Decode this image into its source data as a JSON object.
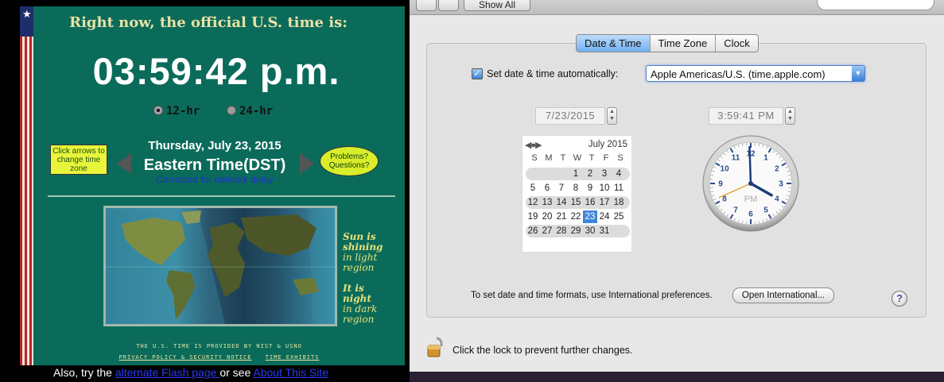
{
  "nist": {
    "headline": "Right now, the official U.S. time is:",
    "time": "03:59:42 p.m.",
    "format_12": "12-hr",
    "format_24": "24-hr",
    "click_arrows": "Click arrows to change time zone",
    "date": "Thursday, July 23, 2015",
    "timezone": "Eastern Time(DST)",
    "corrected": "Corrected for network delay",
    "problems": "Problems? Questions?",
    "sun_line1": "Sun is",
    "sun_line2": "shining",
    "sun_line3": "in light",
    "sun_line4": "region",
    "night_line1": "It is",
    "night_line2": "night",
    "night_line3": "in dark",
    "night_line4": "region",
    "provided": "THE U.S. TIME IS PROVIDED BY NIST & USNO",
    "privacy": "PRIVACY POLICY & SECURITY NOTICE",
    "exhibits": "TIME EXHIBITS",
    "also_prefix": "Also, try the ",
    "alt_flash": "alternate Flash page ",
    "also_mid": "or see ",
    "about": "About This Site"
  },
  "prefs": {
    "show_all": "Show All",
    "tabs": [
      "Date & Time",
      "Time Zone",
      "Clock"
    ],
    "active_tab": "Date & Time",
    "auto_label": "Set date & time automatically:",
    "auto_checked": true,
    "server": "Apple Americas/U.S. (time.apple.com)",
    "date_field": "7/23/2015",
    "time_field": "3:59:41 PM",
    "calendar": {
      "month": "July 2015",
      "weekdays": [
        "S",
        "M",
        "T",
        "W",
        "T",
        "F",
        "S"
      ],
      "weeks": [
        [
          "",
          "",
          "",
          "1",
          "2",
          "3",
          "4"
        ],
        [
          "5",
          "6",
          "7",
          "8",
          "9",
          "10",
          "11"
        ],
        [
          "12",
          "13",
          "14",
          "15",
          "16",
          "17",
          "18"
        ],
        [
          "19",
          "20",
          "21",
          "22",
          "23",
          "24",
          "25"
        ],
        [
          "26",
          "27",
          "28",
          "29",
          "30",
          "31",
          ""
        ]
      ],
      "selected": "23"
    },
    "clock": {
      "hour": 3,
      "minute": 59,
      "second": 41,
      "ampm": "PM"
    },
    "intl_text": "To set date and time formats, use International preferences.",
    "open_intl": "Open International...",
    "help": "?",
    "lock_text": "Click the lock to prevent further changes."
  }
}
